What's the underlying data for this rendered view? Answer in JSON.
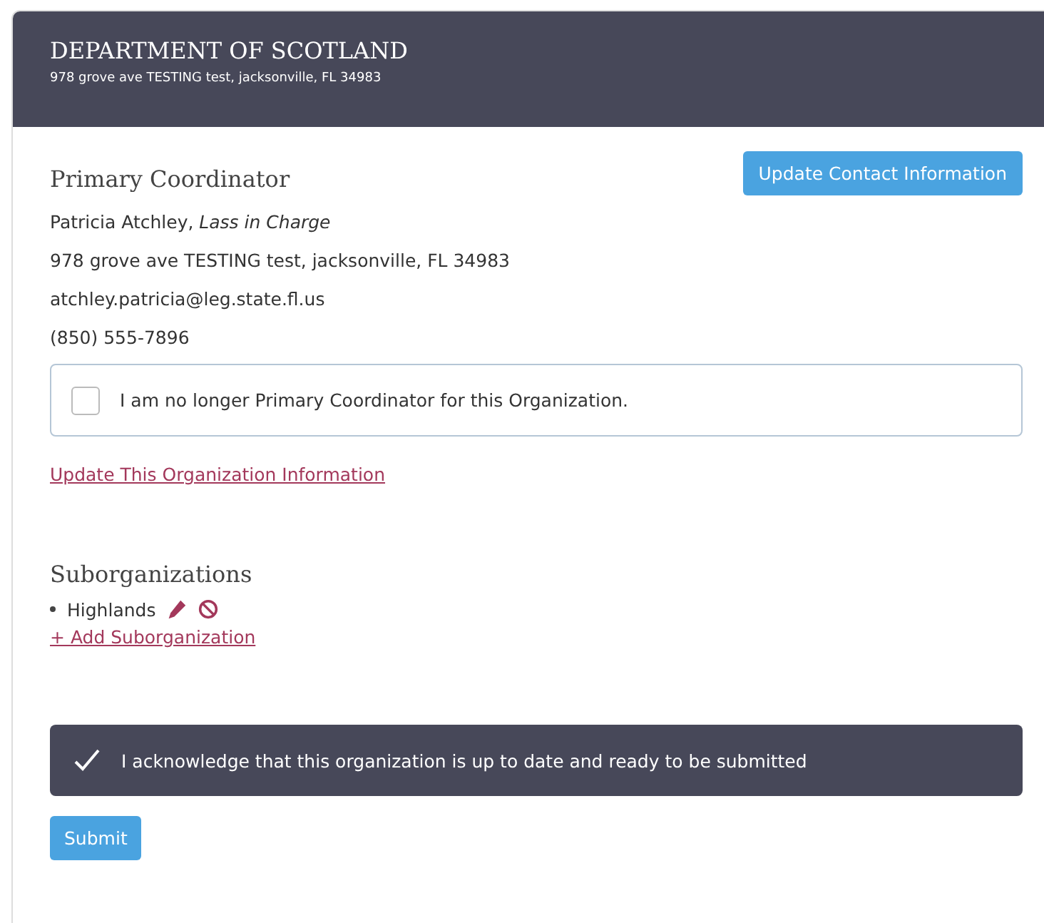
{
  "header": {
    "title": "DEPARTMENT OF SCOTLAND",
    "address": "978 grove ave TESTING test, jacksonville, FL 34983"
  },
  "coordinator": {
    "heading": "Primary Coordinator",
    "update_button": "Update Contact Information",
    "name_line": "Patricia Atchley, *Lass in Charge*",
    "address": "978 grove ave TESTING test, jacksonville, FL 34983",
    "email": "atchley.patricia@leg.state.fl.us",
    "phone": "(850) 555-7896"
  },
  "no_longer_checkbox": {
    "label": "I am no longer Primary Coordinator for this Organization.",
    "checked": false
  },
  "update_org_link": "Update This Organization Information",
  "suborganizations": {
    "heading": "Suborganizations",
    "items": [
      {
        "name": "Highlands"
      }
    ],
    "add_link": "+ Add Suborganization"
  },
  "acknowledge": {
    "label": "I acknowledge that this organization is up to date and ready to be submitted",
    "checked": true
  },
  "submit_button": "Submit"
}
